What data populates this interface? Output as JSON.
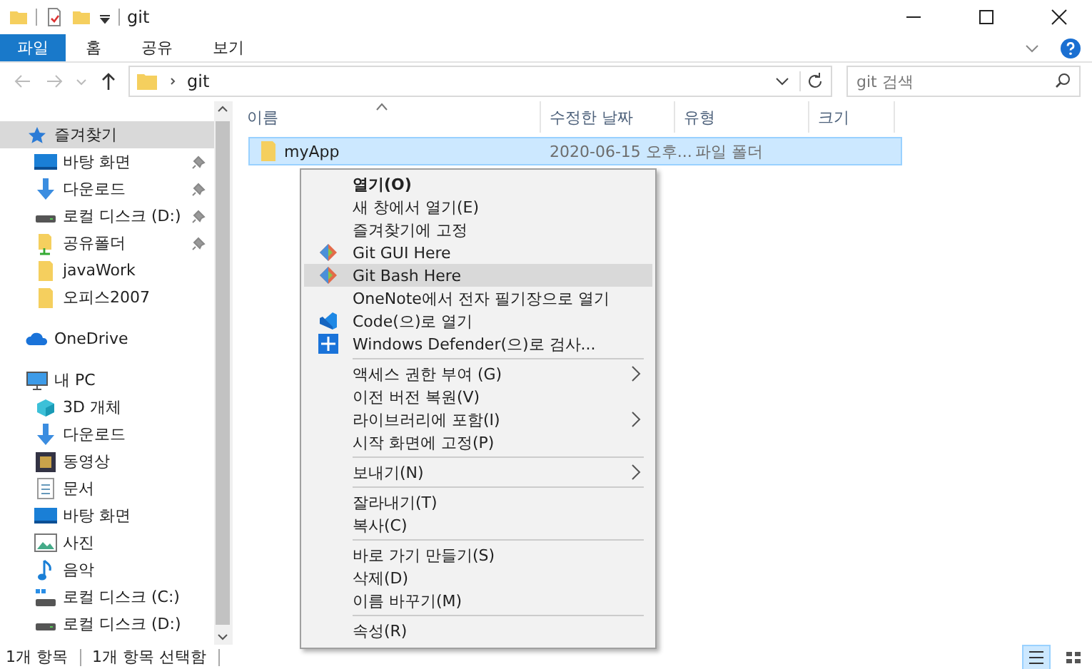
{
  "window": {
    "title": "git"
  },
  "ribbon_tabs": [
    {
      "label": "파일",
      "kind": "file"
    },
    {
      "label": "홈",
      "kind": "tab"
    },
    {
      "label": "공유",
      "kind": "tab"
    },
    {
      "label": "보기",
      "kind": "tab"
    }
  ],
  "address": {
    "path": [
      "git"
    ],
    "search_placeholder": "git 검색"
  },
  "sidebar": {
    "items": [
      {
        "label": "즐겨찾기",
        "kind": "star",
        "selected": true,
        "children": [
          {
            "label": "바탕 화면",
            "kind": "desktop",
            "pinned": true,
            "selected": false
          },
          {
            "label": "다운로드",
            "kind": "download",
            "pinned": true,
            "selected": false
          },
          {
            "label": "로컬 디스크 (D:)",
            "kind": "drive",
            "pinned": true,
            "selected": false
          },
          {
            "label": "공유폴더",
            "kind": "shared",
            "pinned": true,
            "selected": false
          },
          {
            "label": "javaWork",
            "kind": "folder",
            "pinned": false,
            "selected": false
          },
          {
            "label": "오피스2007",
            "kind": "folder",
            "pinned": false,
            "selected": false
          }
        ]
      },
      {
        "label": "OneDrive",
        "kind": "cloud",
        "selected": false
      },
      {
        "label": "내 PC",
        "kind": "pc",
        "selected": false,
        "children": [
          {
            "label": "3D 개체",
            "kind": "cube",
            "pinned": false,
            "selected": false
          },
          {
            "label": "다운로드",
            "kind": "download",
            "pinned": false,
            "selected": false
          },
          {
            "label": "동영상",
            "kind": "video",
            "pinned": false,
            "selected": false
          },
          {
            "label": "문서",
            "kind": "doc",
            "pinned": false,
            "selected": false
          },
          {
            "label": "바탕 화면",
            "kind": "desktop",
            "pinned": false,
            "selected": false
          },
          {
            "label": "사진",
            "kind": "photo",
            "pinned": false,
            "selected": false
          },
          {
            "label": "음악",
            "kind": "music",
            "pinned": false,
            "selected": false
          },
          {
            "label": "로컬 디스크 (C:)",
            "kind": "windrive",
            "pinned": false,
            "selected": false
          },
          {
            "label": "로컬 디스크 (D:)",
            "kind": "drive",
            "pinned": false,
            "selected": false
          }
        ]
      }
    ]
  },
  "table": {
    "columns": [
      {
        "label": "이름",
        "sorted": true
      },
      {
        "label": "수정한 날짜",
        "sorted": false
      },
      {
        "label": "유형",
        "sorted": false
      },
      {
        "label": "크기",
        "sorted": false
      }
    ],
    "rows": [
      {
        "name": "myApp",
        "date": "2020-06-15 오후...",
        "type": "파일 폴더",
        "selected": true
      }
    ]
  },
  "context_menu": [
    {
      "kind": "item",
      "label": "열기(O)",
      "default": true,
      "submenu": false,
      "selected": false
    },
    {
      "kind": "item",
      "label": "새 창에서 열기(E)",
      "default": false,
      "submenu": false,
      "selected": false
    },
    {
      "kind": "item",
      "label": "즐겨찾기에 고정",
      "default": false,
      "submenu": false,
      "selected": false
    },
    {
      "kind": "git",
      "label": "Git GUI Here",
      "default": false,
      "submenu": false,
      "selected": false
    },
    {
      "kind": "git",
      "label": "Git Bash Here",
      "default": false,
      "submenu": false,
      "selected": true
    },
    {
      "kind": "item",
      "label": "OneNote에서 전자 필기장으로 열기",
      "default": false,
      "submenu": false,
      "selected": false
    },
    {
      "kind": "code",
      "label": "Code(으)로 열기",
      "default": false,
      "submenu": false,
      "selected": false
    },
    {
      "kind": "shield",
      "label": "Windows Defender(으)로 검사...",
      "default": false,
      "submenu": false,
      "selected": false
    },
    {
      "kind": "separator"
    },
    {
      "kind": "item",
      "label": "액세스 권한 부여 (G)",
      "default": false,
      "submenu": true,
      "selected": false
    },
    {
      "kind": "item",
      "label": "이전 버전 복원(V)",
      "default": false,
      "submenu": false,
      "selected": false
    },
    {
      "kind": "item",
      "label": "라이브러리에 포함(I)",
      "default": false,
      "submenu": true,
      "selected": false
    },
    {
      "kind": "item",
      "label": "시작 화면에 고정(P)",
      "default": false,
      "submenu": false,
      "selected": false
    },
    {
      "kind": "separator"
    },
    {
      "kind": "item",
      "label": "보내기(N)",
      "default": false,
      "submenu": true,
      "selected": false
    },
    {
      "kind": "separator"
    },
    {
      "kind": "item",
      "label": "잘라내기(T)",
      "default": false,
      "submenu": false,
      "selected": false
    },
    {
      "kind": "item",
      "label": "복사(C)",
      "default": false,
      "submenu": false,
      "selected": false
    },
    {
      "kind": "separator"
    },
    {
      "kind": "item",
      "label": "바로 가기 만들기(S)",
      "default": false,
      "submenu": false,
      "selected": false
    },
    {
      "kind": "item",
      "label": "삭제(D)",
      "default": false,
      "submenu": false,
      "selected": false
    },
    {
      "kind": "item",
      "label": "이름 바꾸기(M)",
      "default": false,
      "submenu": false,
      "selected": false
    },
    {
      "kind": "separator"
    },
    {
      "kind": "item",
      "label": "속성(R)",
      "default": false,
      "submenu": false,
      "selected": false
    }
  ],
  "status_bar": {
    "item_count": "1개 항목",
    "selection": "1개 항목 선택함",
    "view_buttons": [
      {
        "kind": "details",
        "selected": true
      },
      {
        "kind": "tiles",
        "selected": false
      }
    ]
  }
}
